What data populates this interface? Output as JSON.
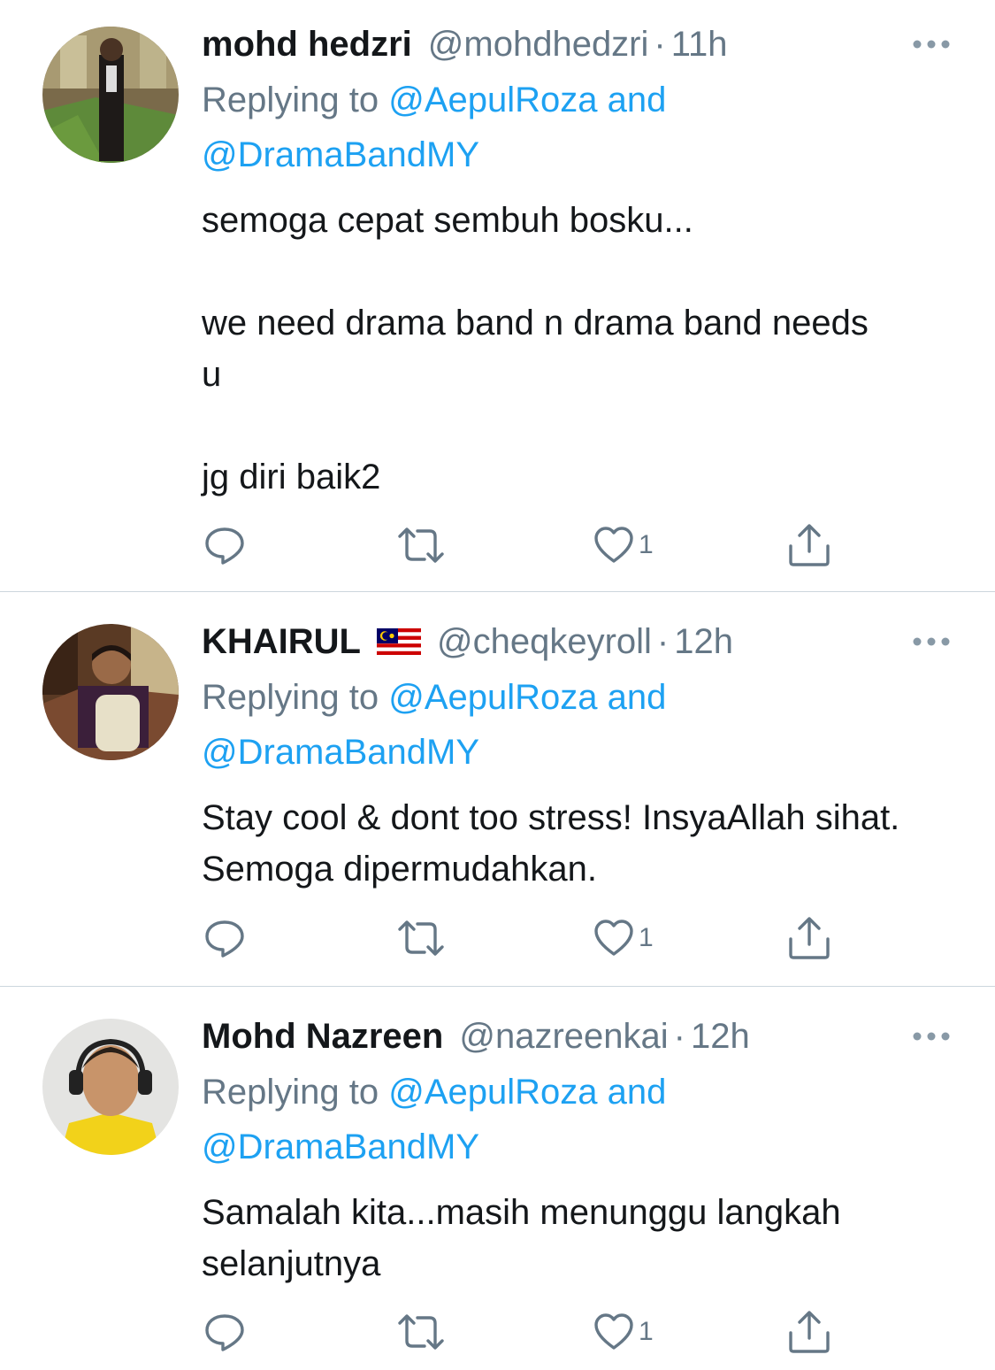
{
  "tweets": [
    {
      "display_name": "mohd hedzri",
      "flag": "",
      "handle": "@mohdhedzri",
      "dot": "·",
      "time": "11h",
      "replying_prefix": "Replying to ",
      "mention_1": "@AepulRoza",
      "and": " and",
      "mention_2": "@DramaBandMY",
      "paragraphs": [
        "semoga cepat sembuh bosku...",
        "we need drama band n drama band needs u",
        "jg diri baik2"
      ],
      "like_count": "1",
      "icons": [
        "reply-icon",
        "retweet-icon",
        "like-icon",
        "share-icon"
      ]
    },
    {
      "display_name": "KHAIRUL",
      "flag": "malaysia-flag",
      "handle": "@cheqkeyroll",
      "dot": "·",
      "time": "12h",
      "replying_prefix": "Replying to ",
      "mention_1": "@AepulRoza",
      "and": " and",
      "mention_2": "@DramaBandMY",
      "paragraphs": [
        "Stay cool & dont too stress! InsyaAllah sihat. Semoga dipermudahkan."
      ],
      "like_count": "1",
      "icons": [
        "reply-icon",
        "retweet-icon",
        "like-icon",
        "share-icon"
      ]
    },
    {
      "display_name": "Mohd Nazreen",
      "flag": "",
      "handle": "@nazreenkai",
      "dot": "·",
      "time": "12h",
      "replying_prefix": "Replying to ",
      "mention_1": "@AepulRoza",
      "and": " and",
      "mention_2": "@DramaBandMY",
      "paragraphs": [
        "Samalah kita...masih menunggu langkah selanjutnya"
      ],
      "like_count": "1",
      "icons": [
        "reply-icon",
        "retweet-icon",
        "like-icon",
        "share-icon"
      ]
    }
  ],
  "colors": {
    "text": "#14171a",
    "secondary": "#657786",
    "link": "#1da1f2",
    "separator": "#ccd6dd"
  }
}
